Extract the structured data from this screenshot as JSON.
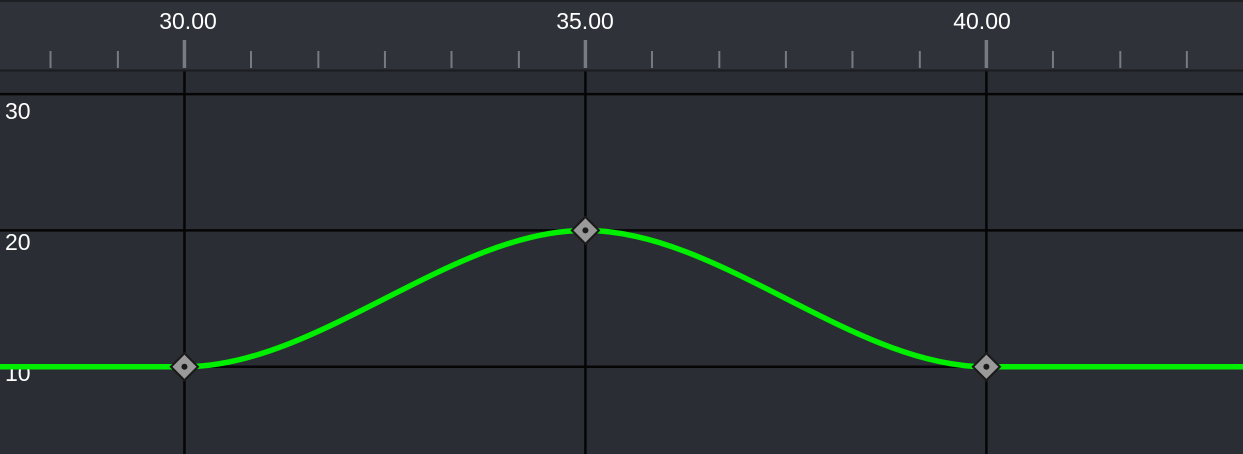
{
  "timeline": {
    "frame_labels": [
      "30.00",
      "35.00",
      "40.00"
    ]
  },
  "value_axis": {
    "labels": [
      "30",
      "20",
      "10"
    ]
  },
  "chart_data": {
    "type": "line",
    "x_range": [
      27.7,
      43.2
    ],
    "y_range": [
      3.6,
      36.9
    ],
    "major_x_ticks": [
      30,
      35,
      40
    ],
    "minor_x_ticks": [
      28.33,
      29.17,
      30.83,
      31.67,
      32.5,
      33.33,
      34.17,
      35.83,
      36.67,
      37.5,
      38.33,
      39.17,
      40.83,
      41.67,
      42.5
    ],
    "y_gridlines": [
      10,
      20,
      30
    ],
    "interpolation": "bezier",
    "keyframes": [
      {
        "frame": 30,
        "value": 10
      },
      {
        "frame": 35,
        "value": 20
      },
      {
        "frame": 40,
        "value": 10
      }
    ],
    "curve_color": "#00ee00",
    "keyframe_color": "#9a9a9a"
  },
  "colors": {
    "background": "#2a2d33",
    "ruler": "#2f3238",
    "gridline": "#050505",
    "ruler_tick": "#777b82",
    "text": "#ffffff"
  }
}
